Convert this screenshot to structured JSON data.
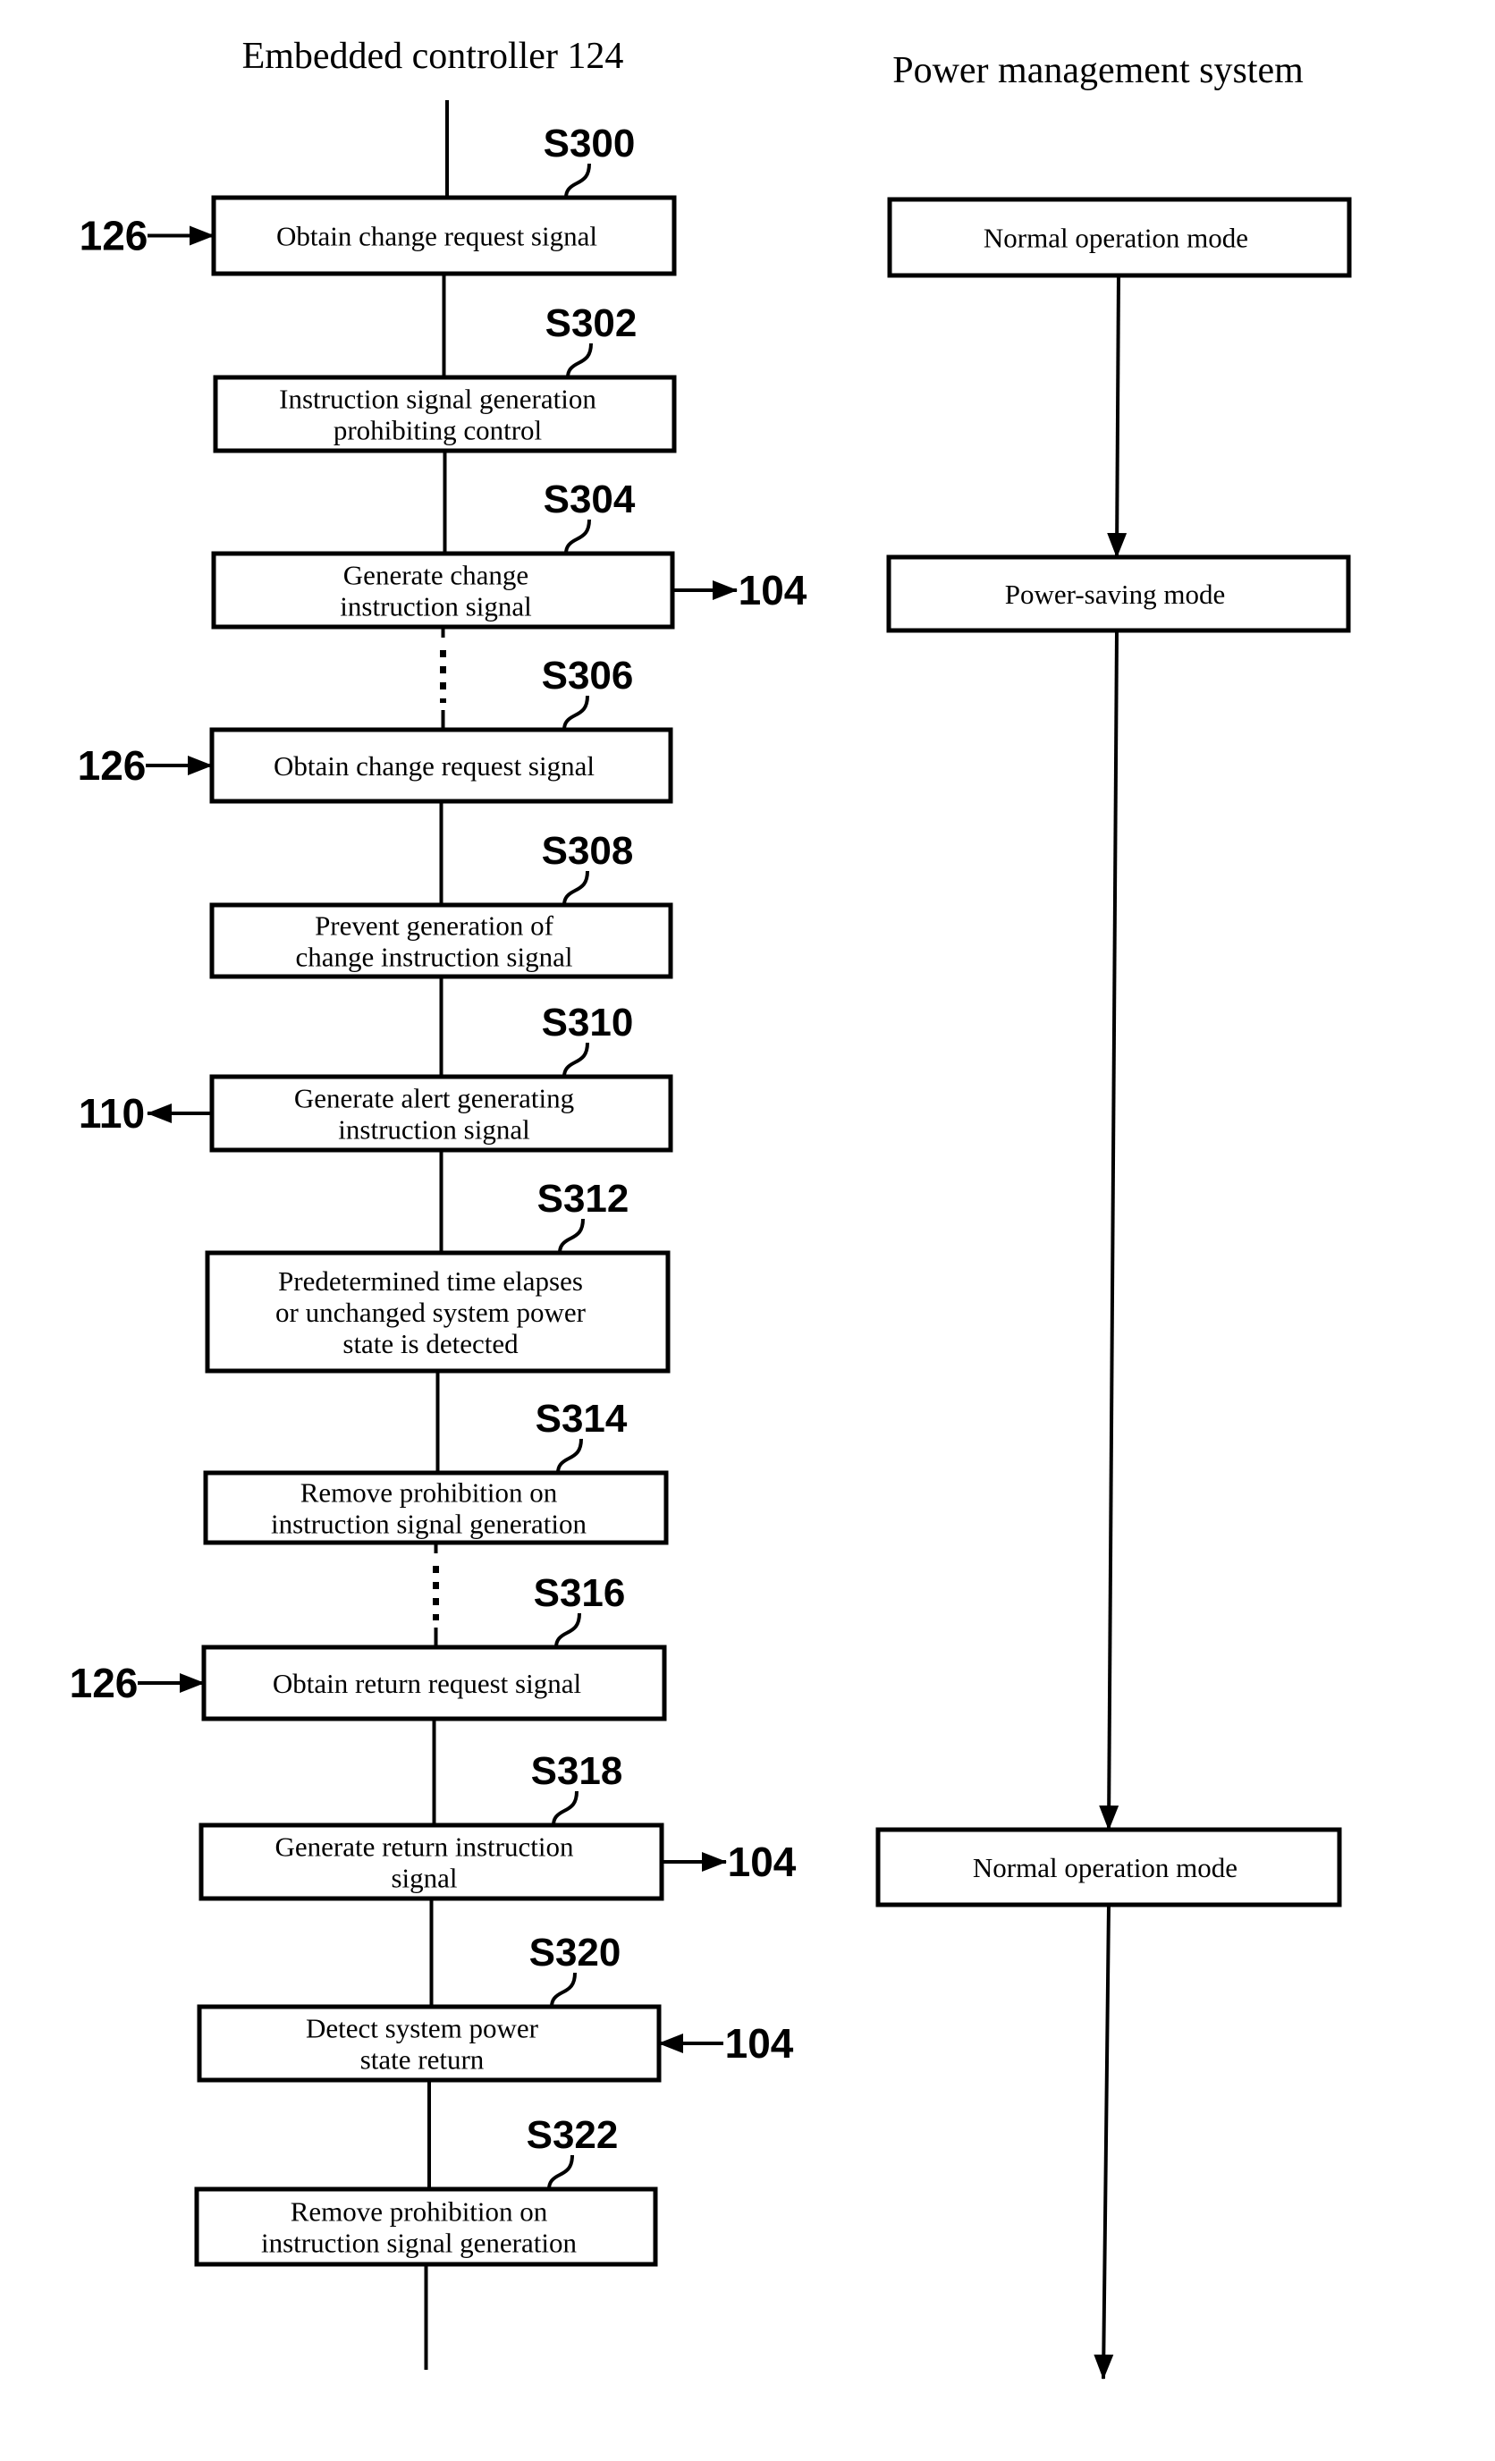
{
  "headers": {
    "left": "Embedded controller 124",
    "right": "Power management system"
  },
  "steps": [
    {
      "id": "S300",
      "lines": [
        "Obtain change request signal"
      ],
      "ref": "126",
      "ref_dir": "in-left"
    },
    {
      "id": "S302",
      "lines": [
        "Instruction signal generation",
        "prohibiting control"
      ]
    },
    {
      "id": "S304",
      "lines": [
        "Generate change",
        "instruction signal"
      ],
      "ref": "104",
      "ref_dir": "out-right"
    },
    {
      "id": "S306",
      "lines": [
        "Obtain change request signal"
      ],
      "ref": "126",
      "ref_dir": "in-left"
    },
    {
      "id": "S308",
      "lines": [
        "Prevent generation of",
        "change instruction signal"
      ]
    },
    {
      "id": "S310",
      "lines": [
        "Generate alert generating",
        "instruction signal"
      ],
      "ref": "110",
      "ref_dir": "out-left"
    },
    {
      "id": "S312",
      "lines": [
        "Predetermined time elapses",
        "or unchanged system power",
        "state is detected"
      ]
    },
    {
      "id": "S314",
      "lines": [
        "Remove prohibition on",
        "instruction signal generation"
      ]
    },
    {
      "id": "S316",
      "lines": [
        "Obtain return request signal"
      ],
      "ref": "126",
      "ref_dir": "in-left"
    },
    {
      "id": "S318",
      "lines": [
        "Generate return instruction",
        "signal"
      ],
      "ref": "104",
      "ref_dir": "out-right"
    },
    {
      "id": "S320",
      "lines": [
        "Detect system power",
        "state return"
      ],
      "ref": "104",
      "ref_dir": "in-right"
    },
    {
      "id": "S322",
      "lines": [
        "Remove prohibition on",
        "instruction signal generation"
      ]
    }
  ],
  "modes": [
    {
      "label": "Normal operation mode"
    },
    {
      "label": "Power-saving mode"
    },
    {
      "label": "Normal operation mode"
    }
  ]
}
